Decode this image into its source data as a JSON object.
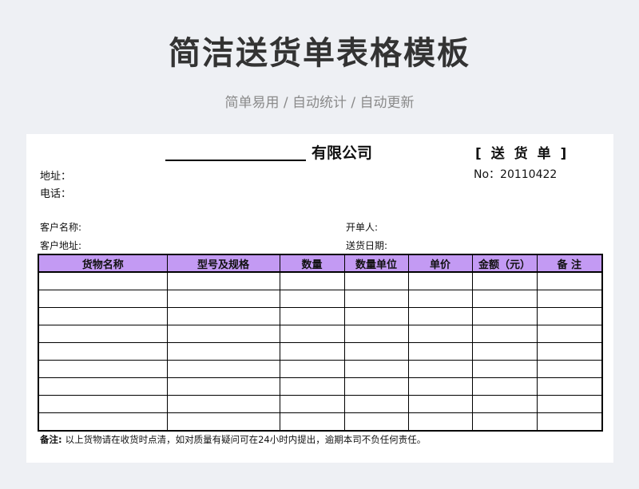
{
  "header": {
    "title": "简洁送货单表格模板",
    "subtitle": "简单易用 / 自动统计 / 自动更新"
  },
  "form": {
    "company_suffix": "有限公司",
    "doc_type": "[ 送 货 单 ]",
    "doc_no": "No：20110422",
    "address_label": "地址：",
    "phone_label": "电话：",
    "customer_name_label": "客户名称:",
    "customer_address_label": "客户地址:",
    "issuer_label": "开单人:",
    "delivery_date_label": "送货日期:"
  },
  "table": {
    "columns": [
      "货物名称",
      "型号及规格",
      "数量",
      "数量单位",
      "单价",
      "金额（元）",
      "备 注"
    ],
    "empty_rows": 9
  },
  "footer": {
    "note_label": "备注:",
    "note_text": "以上货物请在收货时点清，如对质量有疑问可在24小时内提出，逾期本司不负任何责任。"
  }
}
